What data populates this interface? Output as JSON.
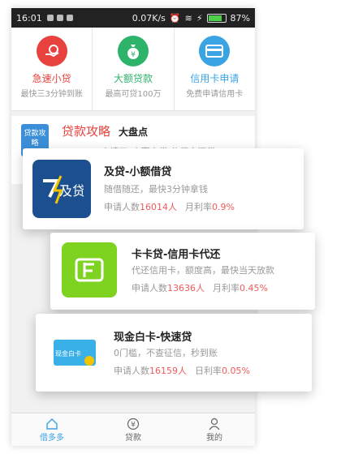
{
  "status_bar": {
    "time": "16:01",
    "speed": "0.07K/s",
    "battery": "87%",
    "battery_level": 0.87
  },
  "quick_links": [
    {
      "title": "急速小贷",
      "subtitle": "最快三3分钟到账",
      "color": "#e8423f",
      "icon": "money-hand-icon"
    },
    {
      "title": "大额贷款",
      "subtitle": "最高可贷100万",
      "color": "#2eb36a",
      "icon": "money-bag-icon"
    },
    {
      "title": "信用卡申请",
      "subtitle": "免费申请信用卡",
      "color": "#3aa3e3",
      "icon": "credit-card-icon"
    }
  ],
  "strategy": {
    "badge": "贷款攻略",
    "title": "贷款攻略",
    "title2": "大盘点",
    "ticker": "Seeing，申请了\"小赢卡贷-信用卡还贷\""
  },
  "loans": [
    {
      "name": "及贷-小额借贷",
      "desc": "随借随还，最快3分钟拿钱",
      "applicants_label": "申请人数",
      "applicants": "16014人",
      "rate_label": "月利率",
      "rate": "0.9%",
      "logo_color": "#1b4f8f",
      "logo_text": "及贷"
    },
    {
      "name": "卡卡贷-信用卡代还",
      "desc": "代还信用卡，额度高，最快当天放款",
      "applicants_label": "申请人数",
      "applicants": "13636人",
      "rate_label": "月利率",
      "rate": "0.45%",
      "logo_color": "#7ed321"
    },
    {
      "name": "现金白卡-快速贷",
      "desc": "0门槛，不查征信，秒到账",
      "applicants_label": "申请人数",
      "applicants": "16159人",
      "rate_label": "日利率",
      "rate": "0.05%",
      "logo_color": "#3ab0e8",
      "card_text": "现金白卡"
    }
  ],
  "tabs": [
    {
      "label": "借多多",
      "icon": "home-icon"
    },
    {
      "label": "贷款",
      "icon": "yen-circle-icon"
    },
    {
      "label": "我的",
      "icon": "user-icon"
    }
  ]
}
